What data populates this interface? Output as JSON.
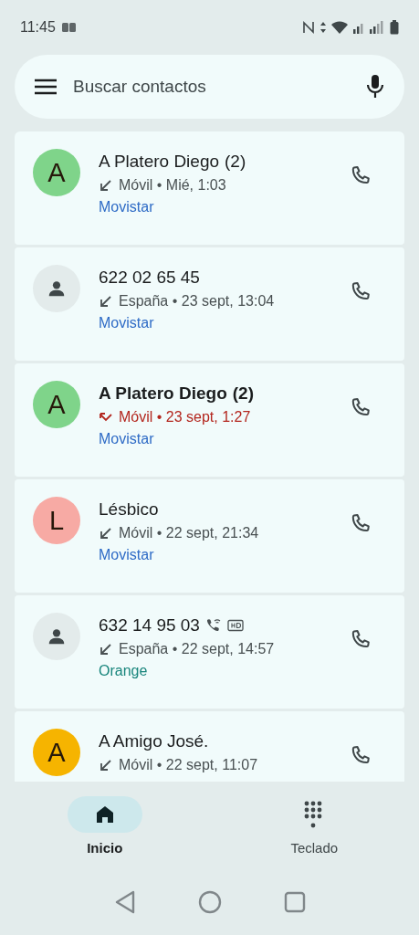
{
  "status_bar": {
    "time": "11:45"
  },
  "search": {
    "placeholder": "Buscar contactos"
  },
  "calls": [
    {
      "name": "A Platero Diego",
      "count": "(2)",
      "avatar": {
        "kind": "letter",
        "letter": "A",
        "color": "#7fd48a"
      },
      "kind": "incoming",
      "details": "Móvil • Mié, 1:03",
      "carrier": {
        "text": "Movistar",
        "color": "#2e6bc6"
      }
    },
    {
      "name": "622 02 65 45",
      "avatar": {
        "kind": "person"
      },
      "kind": "incoming",
      "details": "España • 23 sept, 13:04",
      "carrier": {
        "text": "Movistar",
        "color": "#2e6bc6"
      }
    },
    {
      "name": "A Platero Diego",
      "count": "(2)",
      "avatar": {
        "kind": "letter",
        "letter": "A",
        "color": "#7fd48a"
      },
      "kind": "missed",
      "details": "Móvil • 23 sept, 1:27",
      "carrier": {
        "text": "Movistar",
        "color": "#2e6bc6"
      }
    },
    {
      "name": "Lésbico",
      "avatar": {
        "kind": "letter",
        "letter": "L",
        "color": "#f7aaa4"
      },
      "kind": "incoming",
      "details": "Móvil • 22 sept, 21:34",
      "carrier": {
        "text": "Movistar",
        "color": "#2e6bc6"
      }
    },
    {
      "name": "632 14 95 03",
      "avatar": {
        "kind": "person"
      },
      "kind": "incoming",
      "details": "España • 22 sept, 14:57",
      "carrier": {
        "text": "Orange",
        "color": "#18857c"
      },
      "wifi_calling": true,
      "hd_voice": true
    },
    {
      "name": "A Amigo José.",
      "avatar": {
        "kind": "letter",
        "letter": "A",
        "color": "#f6b400"
      },
      "kind": "incoming",
      "details": "Móvil • 22 sept, 11:07"
    }
  ],
  "nav": [
    {
      "label": "Inicio",
      "kind": "home",
      "selected": true
    },
    {
      "label": "Teclado",
      "kind": "dialpad",
      "selected": false
    }
  ]
}
